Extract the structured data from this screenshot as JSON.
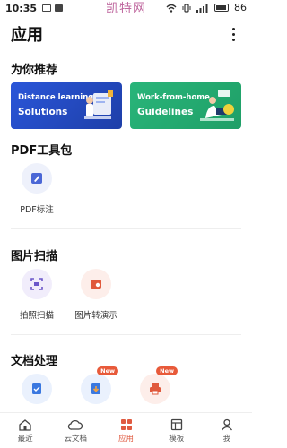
{
  "status_bar": {
    "time": "10:35",
    "watermark": "凯特网",
    "battery": "86"
  },
  "header": {
    "title": "应用"
  },
  "sections": {
    "recommend": "为你推荐",
    "pdf_tools": "PDF工具包",
    "image_scan": "图片扫描",
    "doc_process": "文档处理"
  },
  "banners": [
    {
      "line1": "Distance learning",
      "line2": "Solutions",
      "color": "#2a56d9"
    },
    {
      "line1": "Work-from-home",
      "line2": "Guidelines",
      "color": "#29b57a"
    }
  ],
  "pdf_tools": [
    {
      "label": "PDF标注",
      "icon": "pdf-annotate-icon"
    }
  ],
  "image_scan": [
    {
      "label": "拍照扫描",
      "icon": "scan-icon"
    },
    {
      "label": "图片转演示",
      "icon": "image-to-slides-icon"
    }
  ],
  "doc_process": {
    "badge": "New",
    "items": [
      {
        "icon": "doc-icon"
      },
      {
        "icon": "doc-download-icon",
        "badge": "New"
      },
      {
        "icon": "printer-icon",
        "badge": "New"
      }
    ]
  },
  "tabbar": [
    {
      "label": "最近",
      "icon": "home-icon"
    },
    {
      "label": "云文档",
      "icon": "cloud-icon"
    },
    {
      "label": "应用",
      "icon": "apps-icon",
      "active": true
    },
    {
      "label": "模板",
      "icon": "template-icon"
    },
    {
      "label": "我",
      "icon": "user-icon"
    }
  ],
  "colors": {
    "accent": "#e05a40",
    "blue": "#2a56d9",
    "green": "#29b57a"
  }
}
